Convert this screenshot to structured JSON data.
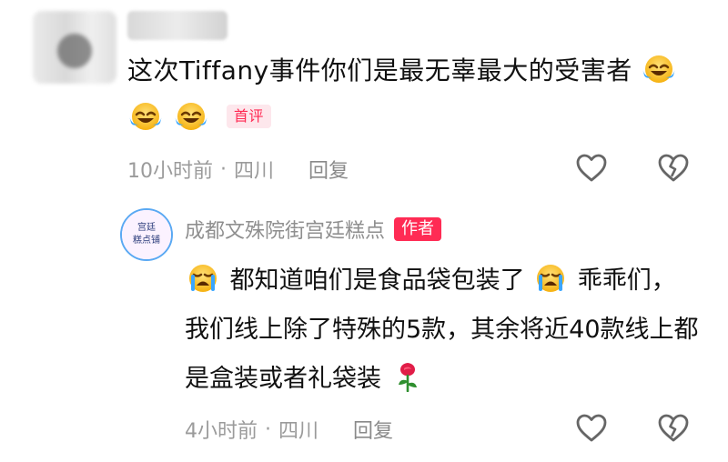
{
  "comment": {
    "text_main": "这次Tiffany事件你们是最无辜最大的受害者",
    "emoji_name": "crying-laughing-face",
    "badge": "首评",
    "time": "10小时前",
    "separator": "·",
    "location": "四川",
    "reply_label": "回复"
  },
  "reply": {
    "author": "成都文殊院街宫廷糕点",
    "author_badge": "作者",
    "avatar_text": "宫廷糕点铺",
    "text_part1": "都知道咱们是食品袋包装了",
    "text_part2": "乖乖们，我们线上除了特殊的5款，其余将近40款线上都是盒装或者礼袋装",
    "emoji_face": "loudly-crying-face",
    "emoji_end": "rose",
    "time": "4小时前",
    "separator": "·",
    "location": "四川",
    "reply_label": "回复"
  },
  "colors": {
    "accent": "#ff2b54",
    "meta_gray": "#9b9b9b",
    "text": "#111111"
  }
}
